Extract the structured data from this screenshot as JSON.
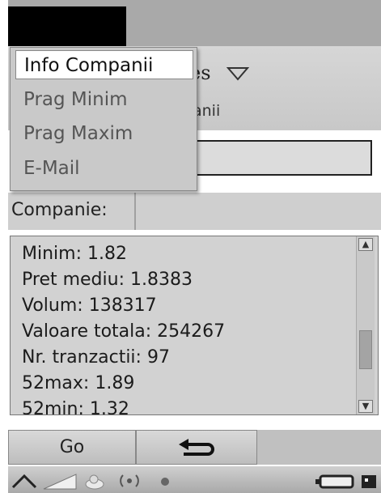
{
  "header": {
    "title_fragment": "es",
    "subtitle_fragment": "anii"
  },
  "menu": {
    "items": [
      {
        "label": "Info Companii",
        "active": true
      },
      {
        "label": "Prag Minim",
        "active": false
      },
      {
        "label": "Prag Maxim",
        "active": false
      },
      {
        "label": "E-Mail",
        "active": false
      }
    ]
  },
  "form": {
    "company_label": "Companie:",
    "input_value": ""
  },
  "details": {
    "lines": [
      "Minim: 1.82",
      "Pret mediu: 1.8383",
      "Volum: 138317",
      "Valoare totala: 254267",
      "Nr. tranzactii: 97",
      "52max: 1.89",
      "52min: 1.32"
    ]
  },
  "buttons": {
    "go_label": "Go",
    "back_icon": "back-arrow-icon"
  },
  "status_icons": [
    "home-icon",
    "signal-icon",
    "presence-icon",
    "wifi-icon",
    "dot-icon",
    "battery-icon",
    "network-icon"
  ]
}
